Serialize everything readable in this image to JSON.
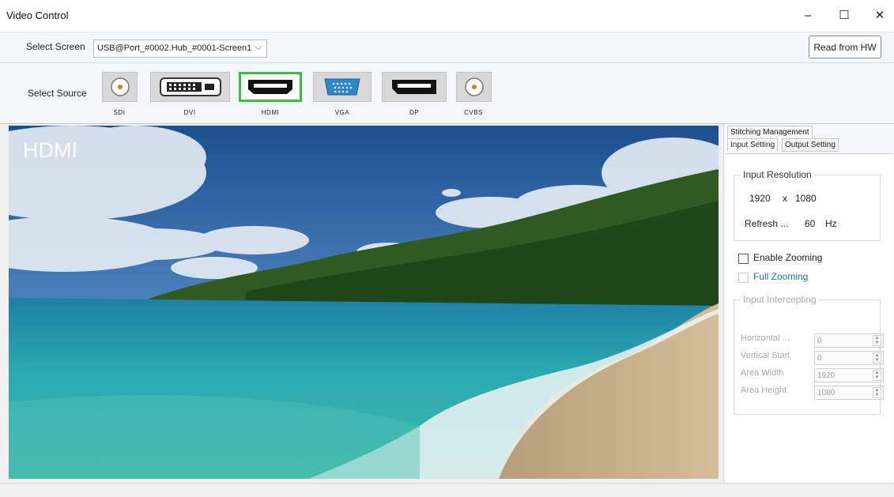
{
  "window": {
    "title": "Video Control",
    "minimize": "–",
    "maximize": "☐",
    "close": "✕"
  },
  "screen_select": {
    "label": "Select Screen",
    "value": "USB@Port_#0002.Hub_#0001-Screen1",
    "read_button": "Read from HW"
  },
  "source_select": {
    "label": "Select Source",
    "sources": [
      {
        "label": "SDI",
        "icon": "bnc-connector-icon",
        "active": false
      },
      {
        "label": "DVI",
        "icon": "dvi-connector-icon",
        "active": false
      },
      {
        "label": "HDMI",
        "icon": "hdmi-connector-icon",
        "active": true
      },
      {
        "label": "VGA",
        "icon": "vga-connector-icon",
        "active": false
      },
      {
        "label": "DP",
        "icon": "displayport-connector-icon",
        "active": false
      },
      {
        "label": "CVBS",
        "icon": "bnc-connector-icon",
        "active": false
      }
    ]
  },
  "preview": {
    "label": "HDMI"
  },
  "panel": {
    "top_tab": "Stitching Management",
    "tabs": [
      "Input Setting",
      "Output Setting"
    ],
    "input_resolution": {
      "legend": "Input Resolution",
      "width": "1920",
      "x": "x",
      "height": "1080",
      "refresh_label": "Refresh ...",
      "refresh_value": "60",
      "refresh_unit": "Hz"
    },
    "enable_zooming": "Enable Zooming",
    "full_zooming": "Full Zooming",
    "input_intercepting": {
      "legend": "Input Intercepting",
      "fields": [
        {
          "label": "Horizontal ...",
          "value": "0"
        },
        {
          "label": "Vertical Start",
          "value": "0"
        },
        {
          "label": "Area Width",
          "value": "1920"
        },
        {
          "label": "Area Height",
          "value": "1080"
        }
      ]
    }
  },
  "colors": {
    "active_source_border": "#38c038",
    "full_zooming_text": "#1f6fb0"
  }
}
